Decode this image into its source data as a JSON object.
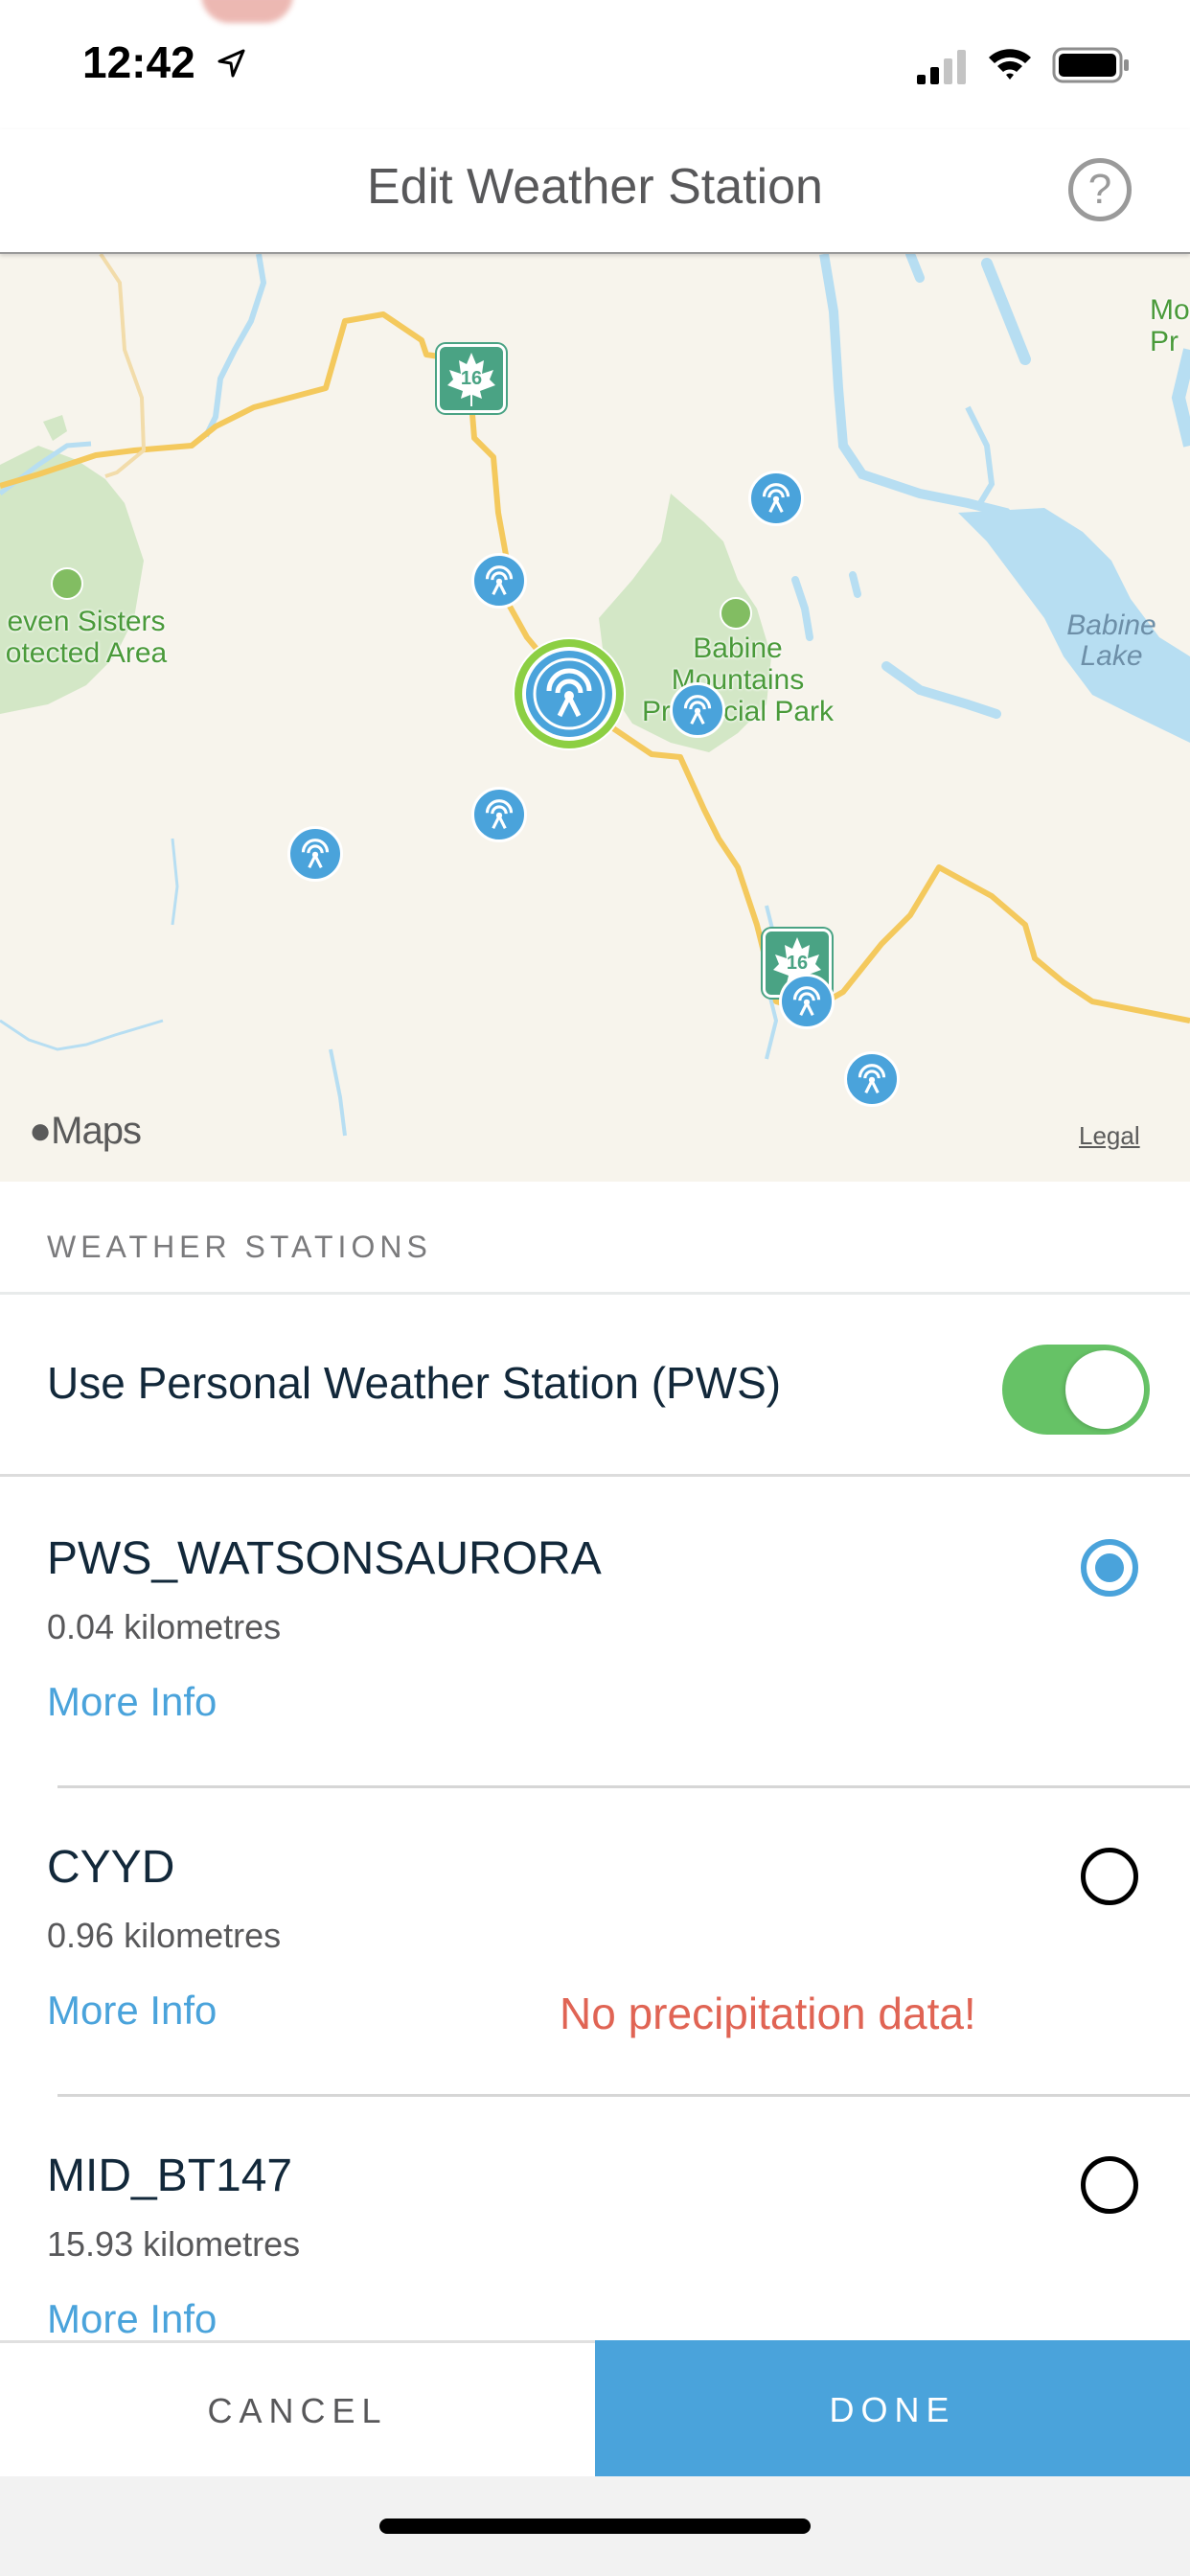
{
  "status_bar": {
    "time": "12:42",
    "location_icon": "location-arrow-icon",
    "signal_icon": "cellular-signal-icon",
    "wifi_icon": "wifi-icon",
    "battery_icon": "battery-icon"
  },
  "header": {
    "title": "Edit Weather Station",
    "help_icon": "question-circle-icon",
    "help_glyph": "?"
  },
  "map": {
    "labels": {
      "park_west_line1": "even Sisters",
      "park_west_line2": "otected Area",
      "park_center_line1": "Babine",
      "park_center_line2": "Mountains",
      "park_center_line3": "Provincial Park",
      "park_ne_line1": "Mo",
      "park_ne_line2": "Pr",
      "lake_line1": "Babine",
      "lake_line2": "Lake"
    },
    "highway_number": "16",
    "attribution": "Maps",
    "legal": "Legal",
    "colors": {
      "land": "#f7f4ec",
      "water": "#b7def2",
      "park": "#d3e7c6",
      "road": "#f4c95d",
      "marker": "#4aa3db",
      "selected_ring": "#8ccf43"
    }
  },
  "section": {
    "title": "WEATHER STATIONS"
  },
  "pws_toggle": {
    "label": "Use Personal Weather Station (PWS)",
    "on": true,
    "color": "#66c266"
  },
  "stations": [
    {
      "name": "PWS_WATSONSAURORA",
      "distance": "0.04 kilometres",
      "more_info": "More Info",
      "warning": "",
      "selected": true
    },
    {
      "name": "CYYD",
      "distance": "0.96 kilometres",
      "more_info": "More Info",
      "warning": "No precipitation data!",
      "selected": false
    },
    {
      "name": "MID_BT147",
      "distance": "15.93 kilometres",
      "more_info": "More Info",
      "warning": "",
      "selected": false
    }
  ],
  "footer": {
    "cancel": "CANCEL",
    "done": "DONE",
    "accent": "#4aa3db"
  }
}
